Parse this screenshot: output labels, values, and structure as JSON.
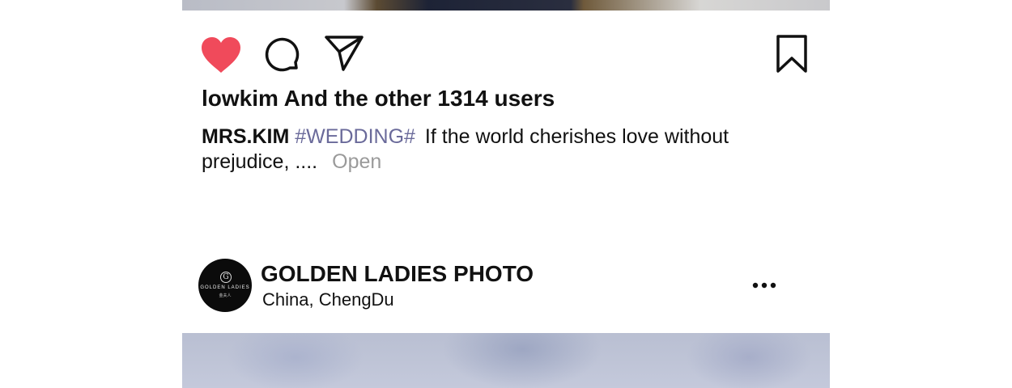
{
  "post_actions": {
    "like_icon": "heart-filled-icon",
    "like_color": "#f04a5b",
    "comment_icon": "comment-bubble-icon",
    "share_icon": "paper-plane-icon",
    "save_icon": "bookmark-icon"
  },
  "likes_text": "lowkim And the other 1314 users",
  "caption": {
    "author": "MRS.KIM",
    "hashtag": "#WEDDING#",
    "text": "If the world cherishes love without prejudice, ....",
    "more_label": "Open"
  },
  "next_post": {
    "avatar": {
      "mark": "G",
      "brand": "GOLDEN LADIES",
      "sub": "金夫人"
    },
    "account_name": "GOLDEN LADIES PHOTO",
    "location_country": "China,",
    "location_city": "ChengDu",
    "more_icon": "more-dots-icon"
  },
  "colors": {
    "hashtag": "#6a6a9a",
    "muted": "#9a9a9a"
  }
}
